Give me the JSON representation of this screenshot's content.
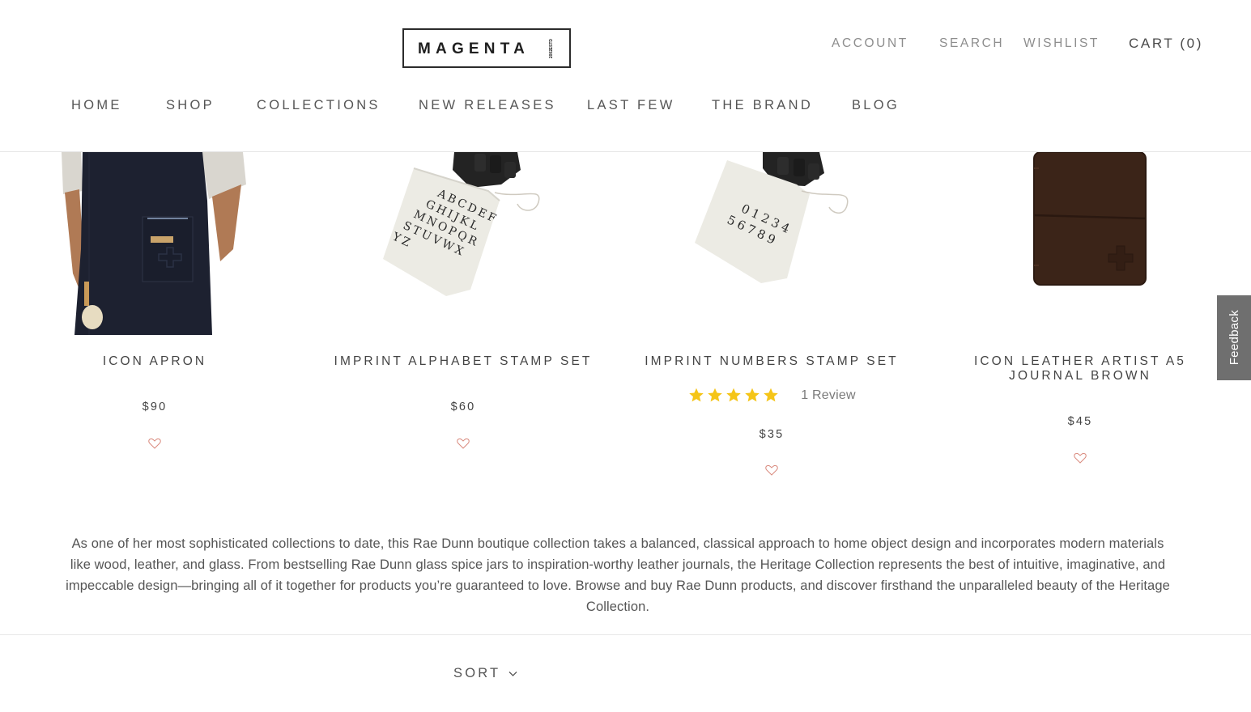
{
  "header": {
    "logo_text": "MAGENTA",
    "logo_estd_top": "ESTD",
    "logo_estd_bottom": "2002",
    "account": "ACCOUNT",
    "search": "SEARCH",
    "wishlist": "WISHLIST",
    "cart": "CART (0)"
  },
  "nav": [
    "HOME",
    "SHOP",
    "COLLECTIONS",
    "NEW RELEASES",
    "LAST FEW",
    "THE BRAND",
    "BLOG"
  ],
  "products": [
    {
      "title": "ICON APRON",
      "price": "$90",
      "image": "black-apron-photo",
      "wishlist_icon": "heart-outline-icon"
    },
    {
      "title": "IMPRINT ALPHABET STAMP SET",
      "price": "$60",
      "image": "alphabet-stamp-bag-photo",
      "bag_lines": [
        "ABCDEF",
        "GHIJKL",
        "MNOPQR",
        "STUVWX",
        "YZ"
      ],
      "wishlist_icon": "heart-outline-icon"
    },
    {
      "title": "IMPRINT NUMBERS STAMP SET",
      "price": "$35",
      "rating": {
        "stars": 5,
        "out_of": 5,
        "review_text": "1 Review"
      },
      "image": "numbers-stamp-bag-photo",
      "bag_lines": [
        "01234",
        "56789"
      ],
      "wishlist_icon": "heart-outline-icon"
    },
    {
      "title_line1": "ICON LEATHER ARTIST A5",
      "title_line2": "JOURNAL BROWN",
      "price": "$45",
      "image": "brown-leather-journal-photo",
      "wishlist_icon": "heart-outline-icon"
    }
  ],
  "description": "As one of her most sophisticated collections to date, this Rae Dunn boutique collection takes a balanced, classical approach to home object design and incorporates modern materials like wood, leather, and glass. From bestselling Rae Dunn glass spice jars to inspiration-worthy leather journals, the Heritage Collection represents the best of intuitive, imaginative, and impeccable design—bringing all of it together for products you’re guaranteed to love. Browse and buy Rae Dunn products, and discover firsthand the unparalleled beauty of the Heritage Collection.",
  "sort": {
    "label": "SORT",
    "icon": "chevron-down-icon"
  },
  "feedback": {
    "label": "Feedback"
  },
  "colors": {
    "star": "#f5c518",
    "heart": "#d98a7e",
    "feedback_bg": "#6f6f6f"
  }
}
